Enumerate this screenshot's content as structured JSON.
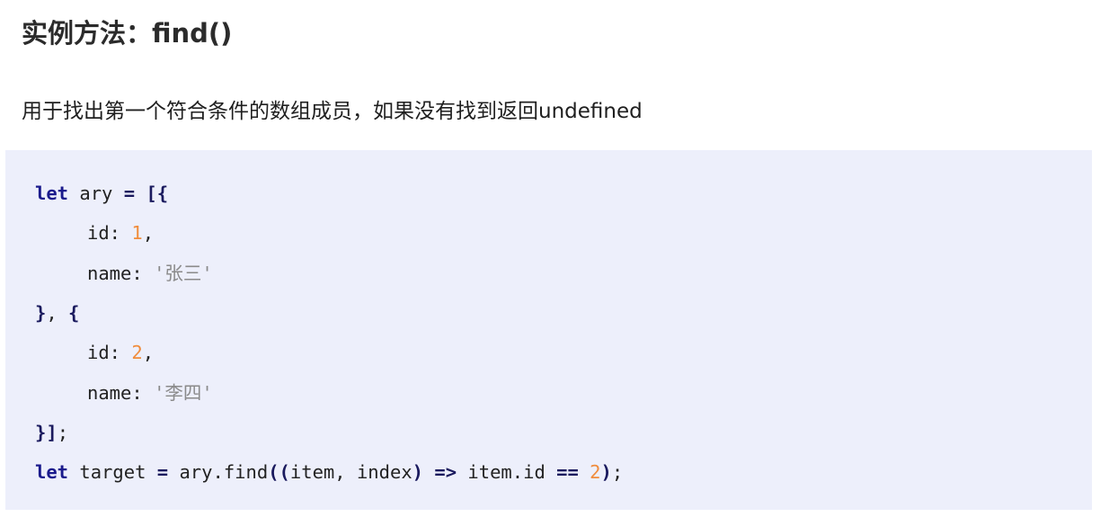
{
  "heading": {
    "title": "实例方法：find()"
  },
  "description": "用于找出第一个符合条件的数组成员，如果没有找到返回undefined",
  "code": {
    "line1": {
      "kw": "let",
      "ident": " ary ",
      "op": "= [{"
    },
    "line2": {
      "key": "id: ",
      "num": "1",
      "punct": ","
    },
    "line3": {
      "key": "name: ",
      "str": "'张三'"
    },
    "line4": {
      "op": "}",
      "rest": ", ",
      "op2": "{"
    },
    "line5": {
      "key": "id: ",
      "num": "2",
      "punct": ","
    },
    "line6": {
      "key": "name: ",
      "str": "'李四'"
    },
    "line7": {
      "op": "}]",
      "rest": ";"
    },
    "line8": {
      "kw": "let",
      "ident1": " target ",
      "op1": "=",
      "ident2": " ary.find",
      "op2": "((",
      "ident3": "item, index",
      "op3": ")",
      "sp1": " ",
      "op4": "=>",
      "ident4": " item.id ",
      "op5": "==",
      "sp2": " ",
      "num": "2",
      "op6": ")",
      "rest": ";"
    }
  }
}
